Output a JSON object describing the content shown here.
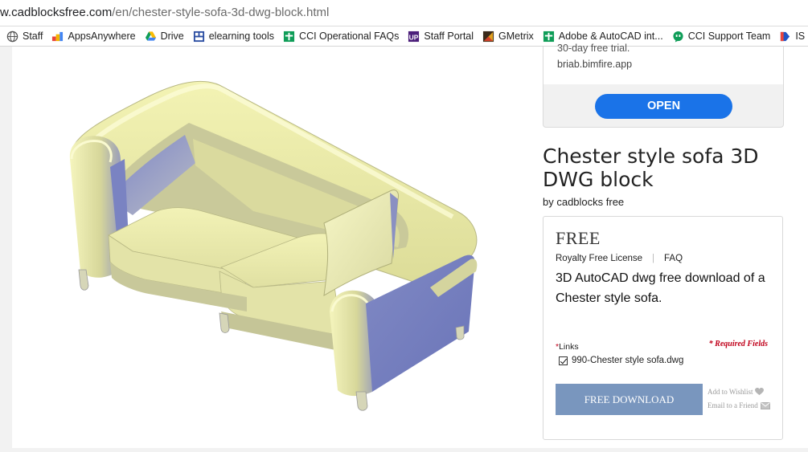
{
  "browser": {
    "url_host": "w.cadblocksfree.com",
    "url_path": "/en/chester-style-sofa-3d-dwg-block.html",
    "bookmarks": [
      {
        "label": "Staff",
        "icon": "globe-icon"
      },
      {
        "label": "AppsAnywhere",
        "icon": "apps-icon"
      },
      {
        "label": "Drive",
        "icon": "drive-icon"
      },
      {
        "label": "elearning tools",
        "icon": "grid-icon"
      },
      {
        "label": "CCI Operational FAQs",
        "icon": "green-plus-icon"
      },
      {
        "label": "Staff Portal",
        "icon": "up-icon"
      },
      {
        "label": "GMetrix",
        "icon": "gmetrix-icon"
      },
      {
        "label": "Adobe & AutoCAD int...",
        "icon": "green-plus-icon"
      },
      {
        "label": "CCI Support Team",
        "icon": "chat-icon"
      },
      {
        "label": "IS",
        "icon": "is-icon"
      }
    ]
  },
  "ad": {
    "trial_text": "30-day free trial.",
    "domain": "briab.bimfire.app",
    "open_label": "OPEN",
    "open_color": "#1a73e8"
  },
  "product": {
    "title": "Chester style sofa 3D DWG block",
    "byline": "by cadblocks free",
    "price": "FREE",
    "license": "Royalty Free License",
    "faq": "FAQ",
    "description": "3D AutoCAD dwg free download of a Chester style sofa.",
    "required_note": "* Required Fields",
    "links_star": "*",
    "links_label": "Links",
    "file_name": "990-Chester style sofa.dwg",
    "file_checked": true,
    "download_label": "FREE DOWNLOAD",
    "download_color": "#7996be",
    "wishlist": "Add to Wishlist",
    "email_friend": "Email to a Friend"
  },
  "image": {
    "subject": "chester-sofa-3d-render",
    "colors": {
      "light": "#f0f0a8",
      "shade": "#6f7cbf"
    }
  }
}
